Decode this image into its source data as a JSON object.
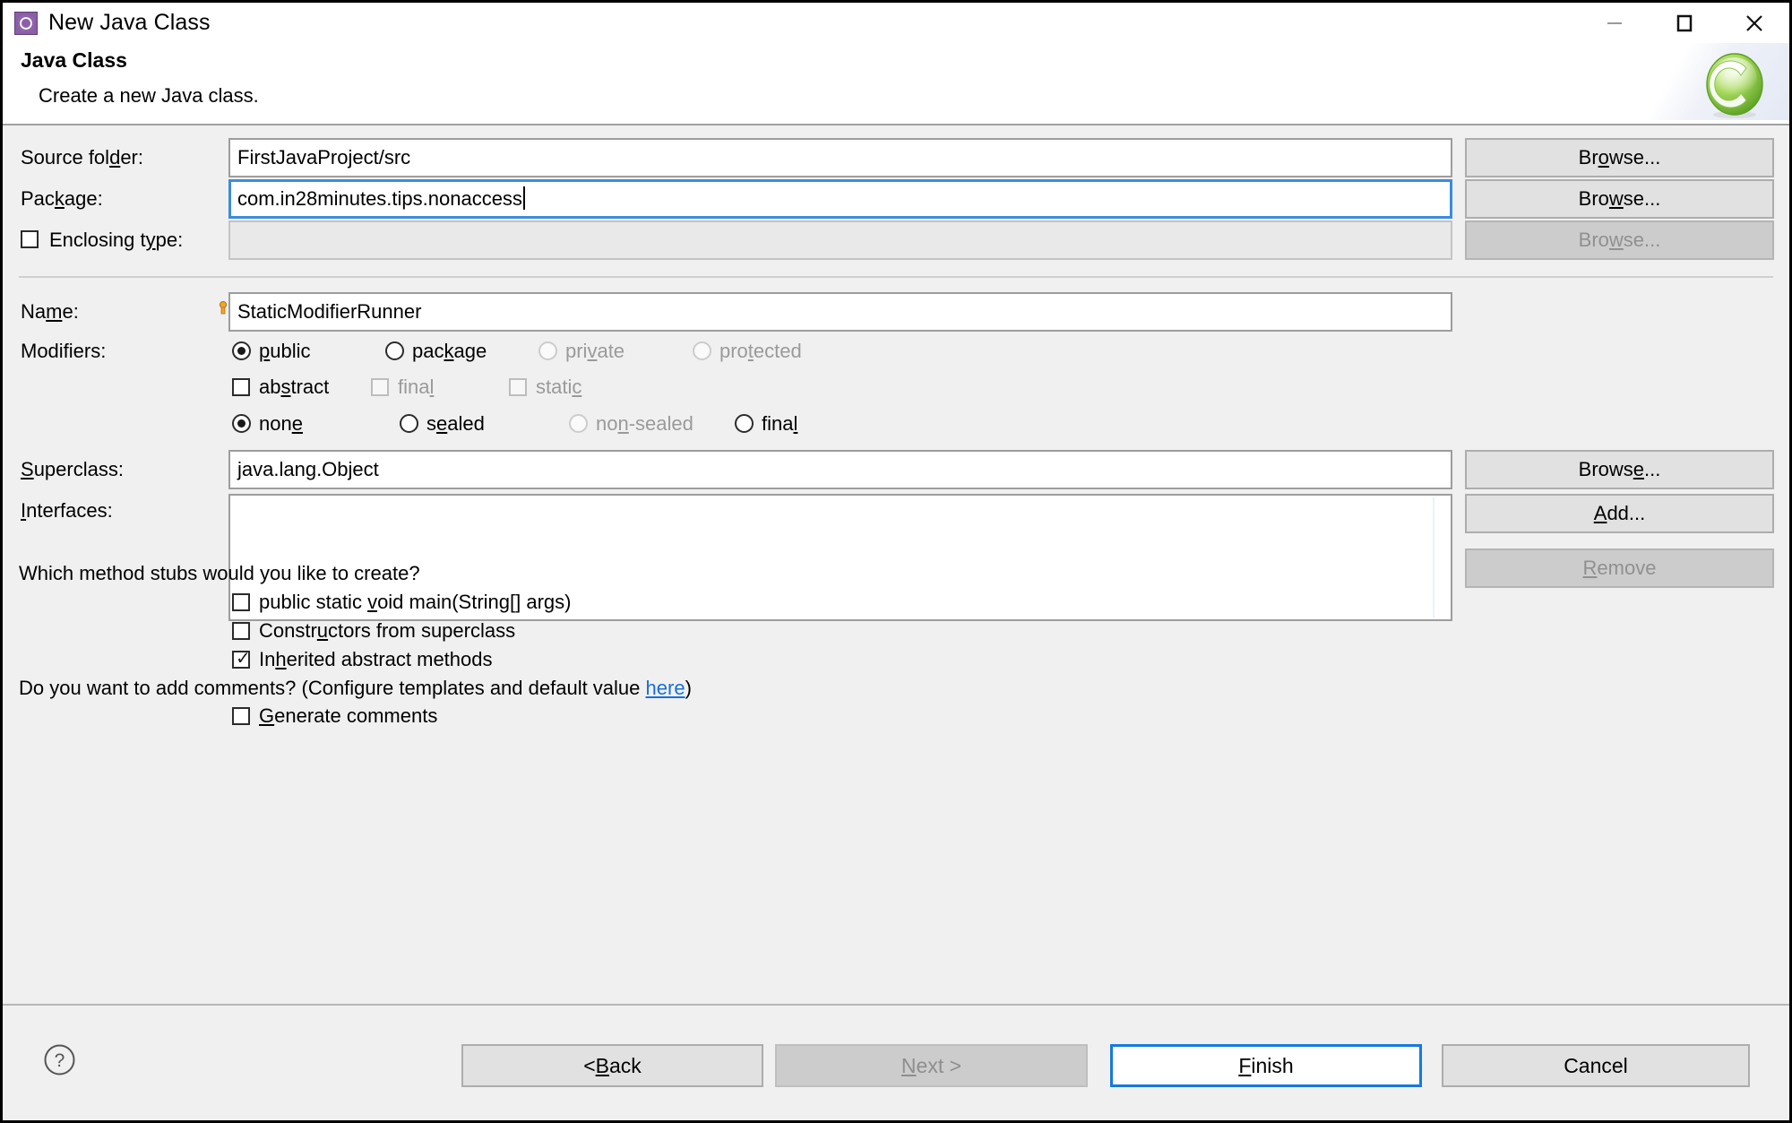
{
  "window": {
    "title": "New Java Class",
    "icon": "java-class-icon",
    "controls": {
      "minimize": "minimize-icon",
      "maximize": "maximize-icon",
      "close": "close-icon"
    }
  },
  "header": {
    "title": "Java Class",
    "description": "Create a new Java class.",
    "logo": "eclipse-wizard-c-logo"
  },
  "form": {
    "source_folder": {
      "label_pre": "Source fol",
      "label_accel": "d",
      "label_post": "er:",
      "value": "FirstJavaProject/src",
      "browse": {
        "pre": "Br",
        "accel": "o",
        "post": "wse..."
      }
    },
    "package": {
      "label_pre": "Pac",
      "label_accel": "k",
      "label_post": "age:",
      "value": "com.in28minutes.tips.nonaccess",
      "browse": {
        "pre": "Bro",
        "accel": "w",
        "post": "se..."
      }
    },
    "enclosing_type": {
      "label_pre": "Enclosing t",
      "label_accel": "y",
      "label_post": "pe:",
      "checked": false,
      "value": "",
      "browse": {
        "pre": "Bro",
        "accel": "w",
        "post": "se..."
      },
      "browse_disabled": true
    },
    "name": {
      "label_pre": "Na",
      "label_accel": "m",
      "label_post": "e:",
      "value": "StaticModifierRunner"
    },
    "modifiers": {
      "label": "Modifiers:",
      "access": [
        {
          "pre": "",
          "accel": "p",
          "post": "ublic",
          "selected": true,
          "disabled": false
        },
        {
          "pre": "pac",
          "accel": "k",
          "post": "age",
          "selected": false,
          "disabled": false
        },
        {
          "pre": "pri",
          "accel": "v",
          "post": "ate",
          "selected": false,
          "disabled": true
        },
        {
          "pre": "pro",
          "accel": "t",
          "post": "ected",
          "selected": false,
          "disabled": true
        }
      ],
      "flags": [
        {
          "pre": "ab",
          "accel": "s",
          "post": "tract",
          "checked": false,
          "disabled": false
        },
        {
          "pre": "fina",
          "accel": "l",
          "post": "",
          "checked": false,
          "disabled": true
        },
        {
          "pre": "stati",
          "accel": "c",
          "post": "",
          "checked": false,
          "disabled": true
        }
      ],
      "sealed": [
        {
          "pre": "non",
          "accel": "e",
          "post": "",
          "selected": true,
          "disabled": false
        },
        {
          "pre": "s",
          "accel": "e",
          "post": "aled",
          "selected": false,
          "disabled": false
        },
        {
          "pre": "no",
          "accel": "n",
          "post": "-sealed",
          "selected": false,
          "disabled": true
        },
        {
          "pre": "fina",
          "accel": "l",
          "post": "",
          "selected": false,
          "disabled": false
        }
      ]
    },
    "superclass": {
      "label_pre": "",
      "label_accel": "S",
      "label_post": "uperclass:",
      "value": "java.lang.Object",
      "browse": {
        "pre": "Brows",
        "accel": "e",
        "post": "..."
      }
    },
    "interfaces": {
      "label_pre": "",
      "label_accel": "I",
      "label_post": "nterfaces:",
      "items": [],
      "add": {
        "pre": "",
        "accel": "A",
        "post": "dd..."
      },
      "remove": {
        "pre": "",
        "accel": "R",
        "post": "emove"
      },
      "remove_disabled": true
    },
    "stubs": {
      "question": "Which method stubs would you like to create?",
      "options": [
        {
          "pre": "public static ",
          "accel": "v",
          "post": "oid main(String[] args)",
          "checked": false
        },
        {
          "pre": "Constr",
          "accel": "u",
          "post": "ctors from superclass",
          "checked": false
        },
        {
          "pre": "In",
          "accel": "h",
          "post": "erited abstract methods",
          "checked": true
        }
      ]
    },
    "comments": {
      "question_pre": "Do you want to add comments? (Configure templates and default value ",
      "link": "here",
      "question_post": ")",
      "option": {
        "pre": "",
        "accel": "G",
        "post": "enerate comments",
        "checked": false
      }
    }
  },
  "footer": {
    "help": "help-icon",
    "back": {
      "pre": "< ",
      "accel": "B",
      "post": "ack",
      "disabled": false
    },
    "next": {
      "pre": "",
      "accel": "N",
      "post": "ext >",
      "disabled": true
    },
    "finish": {
      "pre": "",
      "accel": "F",
      "post": "inish",
      "default": true
    },
    "cancel": {
      "pre": "Cancel",
      "accel": "",
      "post": "",
      "disabled": false
    }
  },
  "colors": {
    "dialog_bg": "#f0f0f0",
    "field_bg": "#ffffff",
    "focus_blue": "#3a8ddd",
    "default_button_blue": "#1679e0",
    "link_blue": "#1a6fd4",
    "disabled_text": "#9a9a9a",
    "logo_green": "#7fc241",
    "icon_purple": "#8b5ea8"
  }
}
